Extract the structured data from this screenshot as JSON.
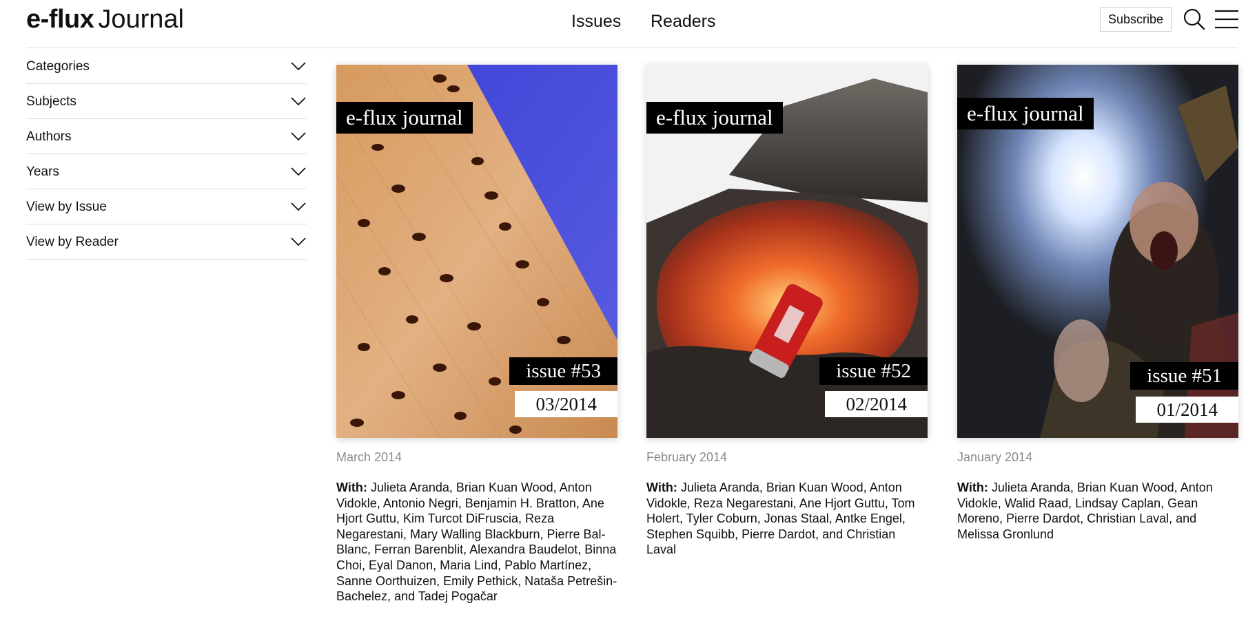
{
  "header": {
    "logo_bold": "e-flux",
    "logo_regular": "Journal",
    "nav": [
      "Issues",
      "Readers"
    ],
    "subscribe_label": "Subscribe",
    "search_icon": "search-icon",
    "menu_icon": "hamburger-menu-icon"
  },
  "sidebar": {
    "items": [
      {
        "label": "Categories"
      },
      {
        "label": "Subjects"
      },
      {
        "label": "Authors"
      },
      {
        "label": "Years"
      },
      {
        "label": "View by Issue"
      },
      {
        "label": "View by Reader"
      }
    ],
    "item_icon": "chevron-down-icon"
  },
  "issues": [
    {
      "masthead": "e-flux journal",
      "issue_label": "issue #53",
      "date_label": "03/2014",
      "month": "March 2014",
      "with_label": "With:",
      "contributors": "Julieta Aranda, Brian Kuan Wood, Anton Vidokle, Antonio Negri, Benjamin H. Bratton, Ane Hjort Guttu, Kim Turcot DiFruscia, Reza Negarestani, Mary Walling Blackburn, Pierre Bal-Blanc, Ferran Barenblit, Alexandra Baudelot, Binna Choi, Eyal Danon, Maria Lind, Pablo Martínez, Sanne Oorthuizen, Emily Pethick, Nataša Petrešin-Bachelez, and Tadej Pogačar",
      "cover_art": "ants-on-wood-photo"
    },
    {
      "masthead": "e-flux journal",
      "issue_label": "issue #52",
      "date_label": "02/2014",
      "month": "February 2014",
      "with_label": "With:",
      "contributors": "Julieta Aranda, Brian Kuan Wood, Anton Vidokle, Reza Negarestani, Ane Hjort Guttu, Tom Holert, Tyler Coburn, Jonas Staal, Antke Engel, Stephen Squibb, Pierre Dardot, and Christian Laval",
      "cover_art": "lava-soda-can-photo"
    },
    {
      "masthead": "e-flux journal",
      "issue_label": "issue #51",
      "date_label": "01/2014",
      "month": "January 2014",
      "with_label": "With:",
      "contributors": "Julieta Aranda, Brian Kuan Wood, Anton Vidokle, Walid Raad, Lindsay Caplan, Gean Moreno, Pierre Dardot, Christian Laval, and Melissa Gronlund",
      "cover_art": "glowing-eyes-sorcerer-photo"
    }
  ]
}
